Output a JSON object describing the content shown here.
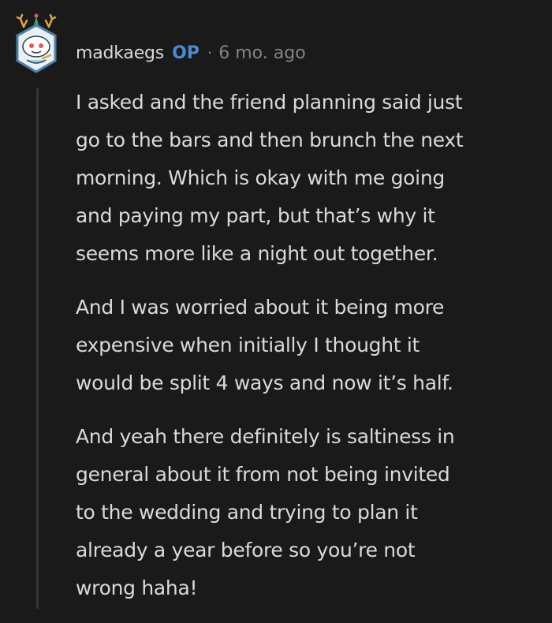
{
  "comment": {
    "author": "madkaegs",
    "badge": "OP",
    "separator": "·",
    "timestamp": "6 mo. ago",
    "paragraphs": [
      {
        "lines": [
          "I asked and the friend planning said just",
          "go to the bars and then brunch the next",
          "morning. Which is okay with me going",
          "and paying my part, but that’s why it",
          "seems more like a night out together."
        ]
      },
      {
        "lines": [
          "And I was worried about it being more",
          "expensive when initially I thought it",
          "would be split 4 ways and now it’s half."
        ]
      },
      {
        "lines": [
          "And yeah there definitely is saltiness in",
          "general about it from not being invited",
          "to the wedding and trying to plan it",
          "already a year before so you’re not",
          "wrong haha!"
        ]
      }
    ]
  },
  "colors": {
    "background": "#1a1a1b",
    "text": "#d7dadc",
    "op_badge": "#4a8ad4",
    "muted": "#818384"
  },
  "icons": {
    "avatar": "snoo-avatar-icon"
  }
}
